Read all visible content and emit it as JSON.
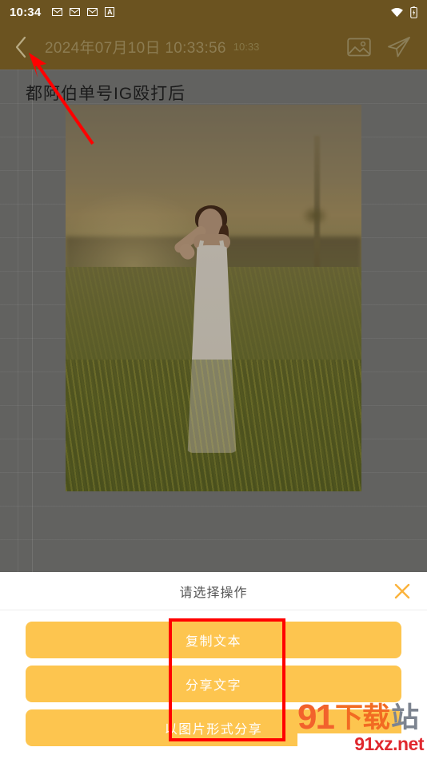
{
  "colors": {
    "toolbar_bg": "#6B5320",
    "note_bg": "#626260",
    "accent_orange": "#FDC54F",
    "highlight_red": "#FF0000",
    "sheet_bg": "#FFFFFF"
  },
  "statusbar": {
    "time": "10:34",
    "icons": [
      "message-icon",
      "message-icon",
      "message-icon",
      "letter-a-icon"
    ],
    "right_icons": [
      "wifi-icon",
      "battery-charging-icon"
    ]
  },
  "toolbar": {
    "back_icon": "chevron-left-icon",
    "date": "2024年07月10日 10:33:56",
    "time_small": "10:33",
    "image_icon": "image-icon",
    "send_icon": "send-icon"
  },
  "note": {
    "title": "都阿伯单号IG殴打后",
    "photo_alt": "woman-in-white-dress-rice-field-photo"
  },
  "sheet": {
    "title": "请选择操作",
    "close_icon": "close-icon",
    "buttons": [
      {
        "label": "复制文本",
        "name": "copy-text-button"
      },
      {
        "label": "分享文字",
        "name": "share-text-button"
      },
      {
        "label": "以图片形式分享",
        "name": "share-as-image-button"
      }
    ]
  },
  "annotations": {
    "arrow_target": "back-button",
    "highlight_target": "sheet-action-buttons"
  },
  "watermark": {
    "num": "91",
    "cn1": "下载",
    "cn2": "站",
    "url": "91xz.net"
  }
}
